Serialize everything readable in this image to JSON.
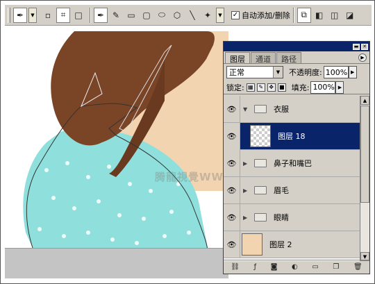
{
  "toolbar": {
    "auto_add_delete_label": "自动添加/删除",
    "auto_add_delete_checked": "✓"
  },
  "watermark": "腾龍視覺WWW.TLVI.NET",
  "layers_panel": {
    "tabs": [
      {
        "label": "图层"
      },
      {
        "label": "通道"
      },
      {
        "label": "路径"
      }
    ],
    "blend_mode": "正常",
    "opacity_label": "不透明度:",
    "opacity_value": "100%",
    "lock_label": "锁定:",
    "fill_label": "填充:",
    "fill_value": "100%",
    "layers": [
      {
        "name": "衣服",
        "type": "group",
        "expanded": "▼"
      },
      {
        "name": "图层 18",
        "type": "layer",
        "selected": true
      },
      {
        "name": "鼻子和嘴巴",
        "type": "group",
        "expanded": "▶"
      },
      {
        "name": "眉毛",
        "type": "group",
        "expanded": "▶"
      },
      {
        "name": "眼睛",
        "type": "group",
        "expanded": "▶"
      },
      {
        "name": "图层 2",
        "type": "layer"
      }
    ]
  }
}
